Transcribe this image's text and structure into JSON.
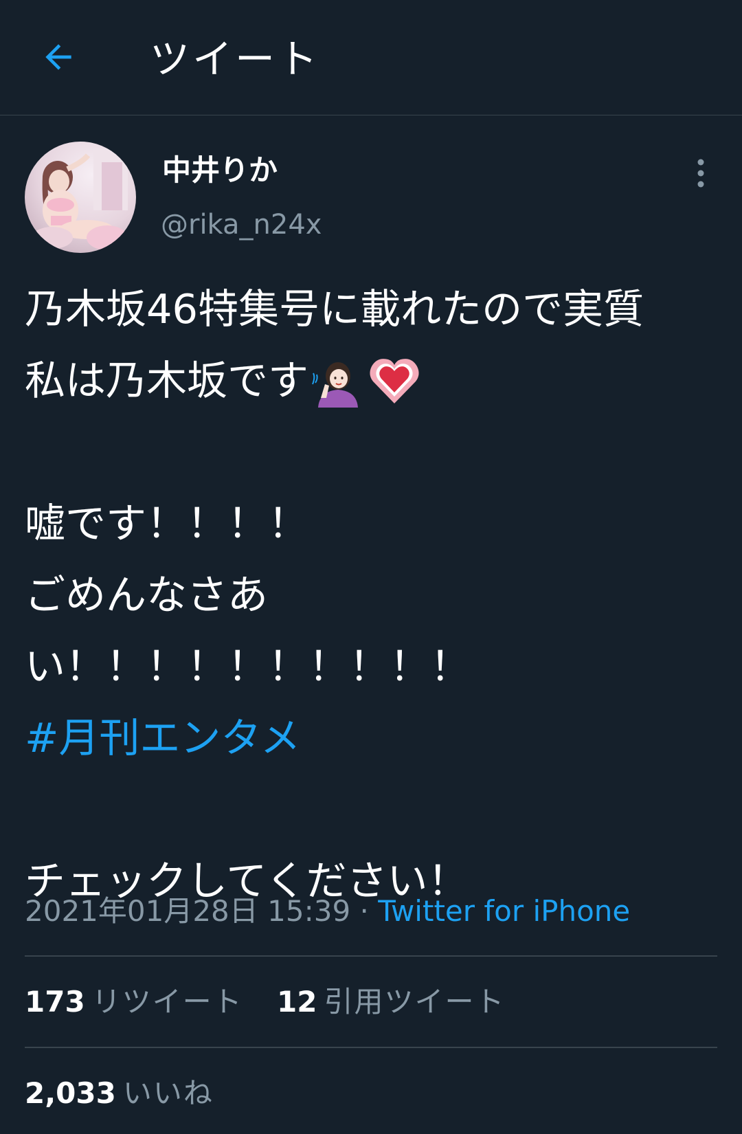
{
  "header": {
    "back_icon": "arrow-left-icon",
    "title": "ツイート"
  },
  "colors": {
    "background": "#15202b",
    "accent": "#1da1f2",
    "secondary_text": "#8899a6",
    "divider": "#38444d"
  },
  "author": {
    "avatar_icon": "profile-photo",
    "name": "中井りか",
    "handle": "@rika_n24x",
    "more_icon": "more-vertical-icon"
  },
  "tweet": {
    "line1": "乃木坂46特集号に載れたので実質",
    "line2": "私は乃木坂です",
    "line2_emojis": [
      "person-tipping-hand-emoji",
      "growing-heart-emoji"
    ],
    "line3": "嘘です！！！！",
    "line4": "ごめんなさあ",
    "line5": "い！！！！！！！！！！",
    "hashtag": "#月刊エンタメ",
    "line6": "チェックしてください！"
  },
  "meta": {
    "timestamp": "2021年01月28日 15:39",
    "separator": "·",
    "source": "Twitter for iPhone"
  },
  "stats": {
    "retweets": {
      "count": "173",
      "label": "リツイート"
    },
    "quotes": {
      "count": "12",
      "label": "引用ツイート"
    },
    "likes": {
      "count": "2,033",
      "label": "いいね"
    }
  }
}
